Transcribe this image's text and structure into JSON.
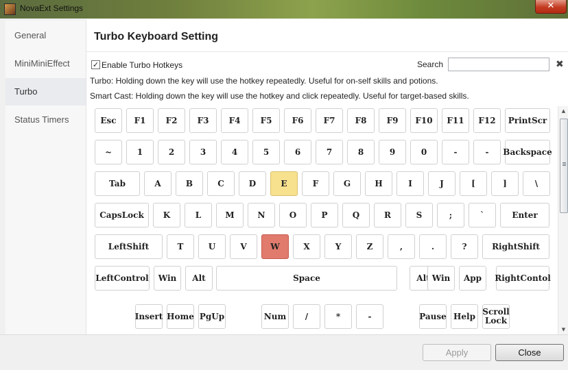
{
  "window": {
    "title": "NovaExt Settings",
    "close_glyph": "✕"
  },
  "sidebar": {
    "items": [
      {
        "label": "General"
      },
      {
        "label": "MiniMiniEffect"
      },
      {
        "label": "Turbo"
      },
      {
        "label": "Status Timers"
      }
    ],
    "active_item": "Turbo"
  },
  "main": {
    "heading": "Turbo Keyboard Setting",
    "enable_label": "Enable Turbo Hotkeys",
    "enable_checked": true,
    "search_label": "Search",
    "search_value": "",
    "search_placeholder": "",
    "clear_glyph": "✖",
    "desc_turbo": "Turbo: Holding down the key will use the hotkey repeatedly. Useful for on-self skills and potions.",
    "desc_smart": "Smart Cast: Holding down the key will use the hotkey and click repeatedly. Useful for target-based skills."
  },
  "keyboard": {
    "rows": [
      [
        "Esc",
        "F1",
        "F2",
        "F3",
        "F4",
        "F5",
        "F6",
        "F7",
        "F8",
        "F9",
        "F10",
        "F11",
        "F12",
        "PrintScr"
      ],
      [
        "~",
        "1",
        "2",
        "3",
        "4",
        "5",
        "6",
        "7",
        "8",
        "9",
        "0",
        "-",
        "-",
        "Backspace"
      ],
      [
        "Tab",
        "A",
        "B",
        "C",
        "D",
        "E",
        "F",
        "G",
        "H",
        "I",
        "J",
        "[",
        "]",
        "\\"
      ],
      [
        "CapsLock",
        "K",
        "L",
        "M",
        "N",
        "O",
        "P",
        "Q",
        "R",
        "S",
        ";",
        "`",
        "Enter"
      ],
      [
        "LeftShift",
        "T",
        "U",
        "V",
        "W",
        "X",
        "Y",
        "Z",
        ",",
        ".",
        "?",
        "RightShift"
      ],
      [
        "LeftControl",
        "Win",
        "Alt",
        "Space",
        "Alt",
        "Win",
        "App",
        "RightContol"
      ],
      [
        "Insert",
        "Home",
        "PgUp",
        "Num",
        "/",
        "*",
        "-",
        "Pause",
        "Help",
        "Scroll\nLock"
      ]
    ],
    "highlighted": {
      "E": "#f7e08e",
      "W": "#e07b6e"
    }
  },
  "scrollbar": {
    "up_glyph": "▲",
    "down_glyph": "▼"
  },
  "footer": {
    "apply_label": "Apply",
    "close_label": "Close"
  }
}
